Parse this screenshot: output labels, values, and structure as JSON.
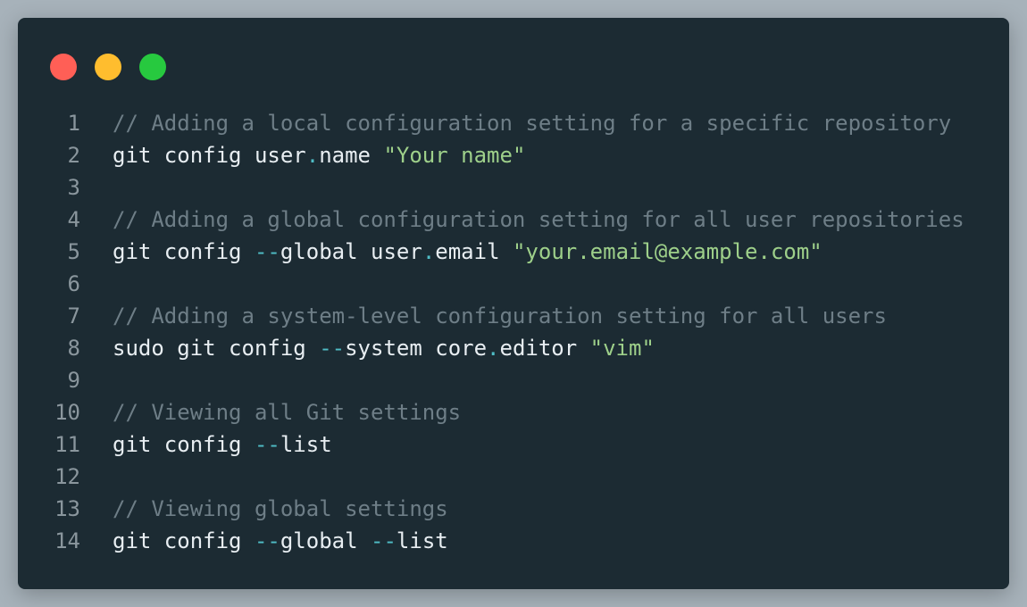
{
  "window": {
    "colors": {
      "background": "#1c2b33",
      "page": "#a7b2ba",
      "comment": "#6e7e87",
      "string": "#9ed08a",
      "punctuation": "#4fbdc6",
      "text": "#e8eef2",
      "line_number": "#8a969d"
    },
    "traffic_lights": [
      {
        "name": "close-button",
        "color": "#ff5f56"
      },
      {
        "name": "minimize-button",
        "color": "#ffbd2e"
      },
      {
        "name": "zoom-button",
        "color": "#27c93f"
      }
    ]
  },
  "code": {
    "lines": [
      {
        "n": "1",
        "tokens": [
          {
            "t": "comment",
            "v": "// Adding a local configuration setting for a specific repository"
          }
        ]
      },
      {
        "n": "2",
        "tokens": [
          {
            "t": "plain",
            "v": "git config user"
          },
          {
            "t": "punct",
            "v": "."
          },
          {
            "t": "plain",
            "v": "name "
          },
          {
            "t": "string",
            "v": "\"Your name\""
          }
        ]
      },
      {
        "n": "3",
        "tokens": []
      },
      {
        "n": "4",
        "tokens": [
          {
            "t": "comment",
            "v": "// Adding a global configuration setting for all user repositories"
          }
        ]
      },
      {
        "n": "5",
        "tokens": [
          {
            "t": "plain",
            "v": "git config "
          },
          {
            "t": "punct",
            "v": "--"
          },
          {
            "t": "plain",
            "v": "global user"
          },
          {
            "t": "punct",
            "v": "."
          },
          {
            "t": "plain",
            "v": "email "
          },
          {
            "t": "string",
            "v": "\"your.email@example.com\""
          }
        ]
      },
      {
        "n": "6",
        "tokens": []
      },
      {
        "n": "7",
        "tokens": [
          {
            "t": "comment",
            "v": "// Adding a system-level configuration setting for all users"
          }
        ]
      },
      {
        "n": "8",
        "tokens": [
          {
            "t": "plain",
            "v": "sudo git config "
          },
          {
            "t": "punct",
            "v": "--"
          },
          {
            "t": "plain",
            "v": "system core"
          },
          {
            "t": "punct",
            "v": "."
          },
          {
            "t": "plain",
            "v": "editor "
          },
          {
            "t": "string",
            "v": "\"vim\""
          }
        ]
      },
      {
        "n": "9",
        "tokens": []
      },
      {
        "n": "10",
        "tokens": [
          {
            "t": "comment",
            "v": "// Viewing all Git settings"
          }
        ]
      },
      {
        "n": "11",
        "tokens": [
          {
            "t": "plain",
            "v": "git config "
          },
          {
            "t": "punct",
            "v": "--"
          },
          {
            "t": "plain",
            "v": "list"
          }
        ]
      },
      {
        "n": "12",
        "tokens": []
      },
      {
        "n": "13",
        "tokens": [
          {
            "t": "comment",
            "v": "// Viewing global settings"
          }
        ]
      },
      {
        "n": "14",
        "tokens": [
          {
            "t": "plain",
            "v": "git config "
          },
          {
            "t": "punct",
            "v": "--"
          },
          {
            "t": "plain",
            "v": "global "
          },
          {
            "t": "punct",
            "v": "--"
          },
          {
            "t": "plain",
            "v": "list"
          }
        ]
      }
    ]
  }
}
